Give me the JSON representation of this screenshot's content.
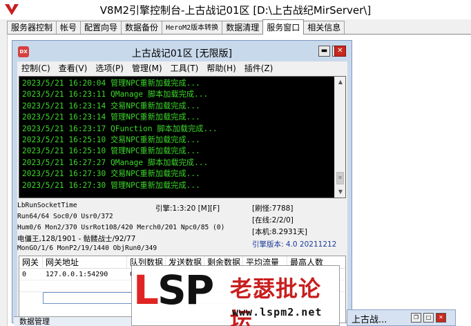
{
  "window": {
    "title": "V8M2引擎控制台-上古战记01区 [D:\\上古战纪MirServer\\]"
  },
  "tabs": [
    {
      "label": "服务器控制"
    },
    {
      "label": "帐号"
    },
    {
      "label": "配置向导"
    },
    {
      "label": "数据备份"
    },
    {
      "label": "HeroM2版本转换"
    },
    {
      "label": "数据清理"
    },
    {
      "label": "服务窗口"
    },
    {
      "label": "相关信息"
    }
  ],
  "inner": {
    "title": "上古战记01区 [无限版]",
    "icon_text": "DX",
    "buttons": {
      "minimize": "▬",
      "maximize": "□",
      "close": "✕"
    },
    "menu": [
      {
        "label": "控制(C)"
      },
      {
        "label": "查看(V)"
      },
      {
        "label": "选项(P)"
      },
      {
        "label": "管理(M)"
      },
      {
        "label": "工具(T)"
      },
      {
        "label": "帮助(H)"
      },
      {
        "label": "插件(Z)"
      }
    ]
  },
  "log": [
    "2023/5/21 16:20:04 管理NPC重新加载完成...",
    "2023/5/21 16:23:11 QManage 脚本加载完成...",
    "2023/5/21 16:23:14 交易NPC重新加载完成...",
    "2023/5/21 16:23:14 管理NPC重新加载完成...",
    "2023/5/21 16:23:17 QFunction 脚本加载完成...",
    "2023/5/21 16:25:10 交易NPC重新加载完成...",
    "2023/5/21 16:25:10 管理NPC重新加载完成...",
    "2023/5/21 16:27:27 QManage 脚本加载完成...",
    "2023/5/21 16:27:30 交易NPC重新加载完成...",
    "2023/5/21 16:27:30 管理NPC重新加载完成..."
  ],
  "stats": {
    "run_socket": "LbRunSocketTime",
    "engine": "引擎:1:3:20 [M][F]",
    "monster": "[刷怪:7788]",
    "run": "Run64/64 Soc0/0 Usr0/372",
    "online": "[在线:2/2/0]",
    "hum": "Hum0/6 Mon2/370 UsrRot108/420 Merch0/201 Npc0/85 (0)",
    "local": "[本机:8.2931天]",
    "boss": "电僵王,128/1901 - 骷髅战士/92/77",
    "version": "引擎版本: 4.0 20211212",
    "mongo": "MonGO/1/6 MonP2/19/1440 ObjRun0/349"
  },
  "gateway": {
    "headers": [
      "网关",
      "网关地址",
      "队列数据",
      "发送数据",
      "剩余数据",
      "平均流量",
      "最高人数"
    ],
    "rows": [
      [
        "0",
        "127.0.0.1:54290",
        "0",
        "",
        "",
        "",
        ""
      ]
    ]
  },
  "watermark": {
    "logo_l": "L",
    "logo_s": "S",
    "logo_p": "P",
    "cn": "老瑟批论坛",
    "url": "www.lspm2.net"
  },
  "taskbar": {
    "bottom_label": "数据管理",
    "minimized_title": "上古战...",
    "minimized_buttons": {
      "restore": "❐",
      "maximize": "□",
      "close": "✕"
    }
  },
  "colors": {
    "log_text": "#3cd82a",
    "accent_red": "#e02424",
    "version_blue": "#1a3a9a"
  }
}
